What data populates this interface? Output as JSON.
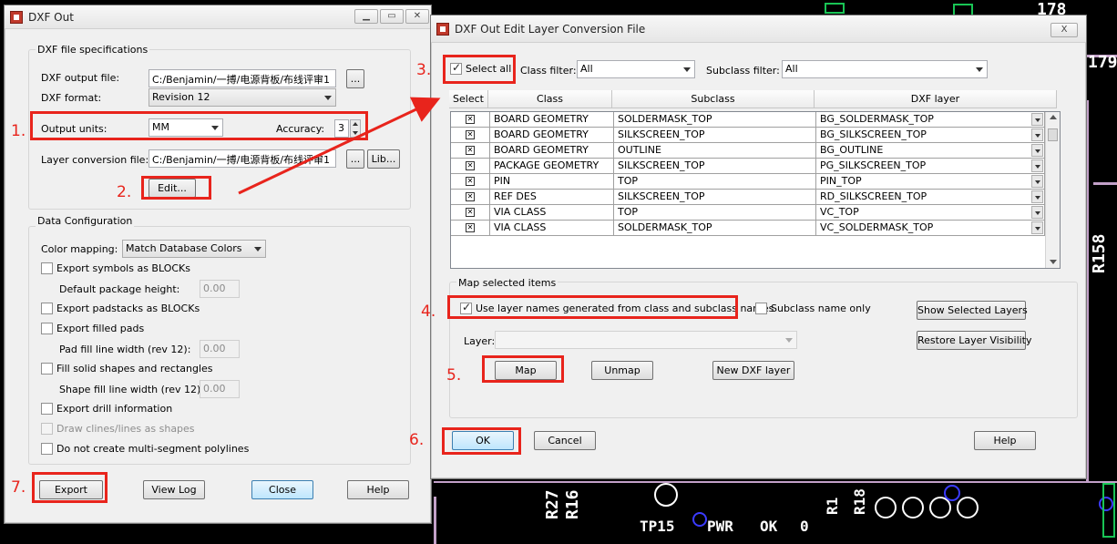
{
  "background_labels": {
    "a": "R158",
    "b": "R27",
    "c": "R16",
    "d": "TP15",
    "e": "PWR",
    "f": "OK",
    "g": "R1",
    "h": "R18",
    "i": "178",
    "j": "179",
    "k": "0"
  },
  "left_window": {
    "title": "DXF Out",
    "spec_group": "DXF file specifications",
    "output_file_label": "DXF output file:",
    "output_file_value": "C:/Benjamin/一搏/电源背板/布线评审1",
    "browse1": "...",
    "format_label": "DXF format:",
    "format_value": "Revision 12",
    "units_label": "Output units:",
    "units_value": "MM",
    "accuracy_label": "Accuracy:",
    "accuracy_value": "3",
    "conv_label": "Layer conversion file:",
    "conv_value": "C:/Benjamin/一搏/电源背板/布线评审1",
    "browse2": "...",
    "lib_button": "Lib...",
    "edit_button": "Edit...",
    "data_group": "Data Configuration",
    "color_label": "Color mapping:",
    "color_value": "Match Database Colors",
    "opt1": "Export symbols as BLOCKs",
    "pkg_height_label": "Default package height:",
    "pkg_height_value": "0.00",
    "opt2": "Export padstacks as BLOCKs",
    "opt3": "Export filled pads",
    "pad_fill_label": "Pad fill line width (rev 12):",
    "pad_fill_value": "0.00",
    "opt4": "Fill solid shapes and rectangles",
    "shape_fill_label": "Shape fill line width (rev 12):",
    "shape_fill_value": "0.00",
    "opt5": "Export drill information",
    "opt6": "Draw clines/lines as shapes",
    "opt7": "Do not create multi-segment polylines",
    "export_button": "Export",
    "viewlog_button": "View Log",
    "close_button": "Close",
    "help_button": "Help"
  },
  "right_window": {
    "title": "DXF Out Edit Layer Conversion File",
    "close_x": "X",
    "select_all": "Select all",
    "class_filter_label": "Class filter:",
    "class_filter_value": "All",
    "subclass_filter_label": "Subclass filter:",
    "subclass_filter_value": "All",
    "headers": {
      "select": "Select",
      "class": "Class",
      "subclass": "Subclass",
      "dxf": "DXF layer"
    },
    "rows": [
      {
        "class": "BOARD GEOMETRY",
        "subclass": "SOLDERMASK_TOP",
        "dxf": "BG_SOLDERMASK_TOP"
      },
      {
        "class": "BOARD GEOMETRY",
        "subclass": "SILKSCREEN_TOP",
        "dxf": "BG_SILKSCREEN_TOP"
      },
      {
        "class": "BOARD GEOMETRY",
        "subclass": "OUTLINE",
        "dxf": "BG_OUTLINE"
      },
      {
        "class": "PACKAGE GEOMETRY",
        "subclass": "SILKSCREEN_TOP",
        "dxf": "PG_SILKSCREEN_TOP"
      },
      {
        "class": "PIN",
        "subclass": "TOP",
        "dxf": "PIN_TOP"
      },
      {
        "class": "REF DES",
        "subclass": "SILKSCREEN_TOP",
        "dxf": "RD_SILKSCREEN_TOP"
      },
      {
        "class": "VIA CLASS",
        "subclass": "TOP",
        "dxf": "VC_TOP"
      },
      {
        "class": "VIA CLASS",
        "subclass": "SOLDERMASK_TOP",
        "dxf": "VC_SOLDERMASK_TOP"
      }
    ],
    "map_group": "Map selected items",
    "use_names": "Use layer names generated from class and subclass names",
    "subclass_only": "Subclass name only",
    "show_selected": "Show Selected Layers",
    "restore_vis": "Restore Layer Visibility",
    "layer_label": "Layer:",
    "map_button": "Map",
    "unmap_button": "Unmap",
    "new_dxf_button": "New DXF layer",
    "ok_button": "OK",
    "cancel_button": "Cancel",
    "help_button": "Help"
  },
  "steps": [
    "1.",
    "2.",
    "3.",
    "4.",
    "5.",
    "6.",
    "7."
  ],
  "colors": {
    "annotation": "#e8241c",
    "pcb_bg": "#000000",
    "trace": "#c2a0c8"
  }
}
